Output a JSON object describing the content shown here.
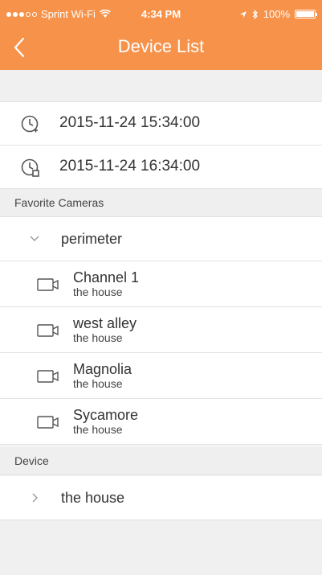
{
  "status_bar": {
    "carrier": "Sprint Wi-Fi",
    "time": "4:34 PM",
    "battery": "100%"
  },
  "header": {
    "title": "Device List"
  },
  "times": [
    {
      "label": "2015-11-24 15:34:00"
    },
    {
      "label": "2015-11-24 16:34:00"
    }
  ],
  "favorites": {
    "section_label": "Favorite Cameras",
    "group_label": "perimeter",
    "cameras": [
      {
        "name": "Channel 1",
        "location": "the house"
      },
      {
        "name": "west alley",
        "location": "the house"
      },
      {
        "name": "Magnolia",
        "location": "the house"
      },
      {
        "name": "Sycamore",
        "location": "the house"
      }
    ]
  },
  "devices": {
    "section_label": "Device",
    "items": [
      {
        "label": "the house"
      }
    ]
  },
  "colors": {
    "accent": "#f7924a"
  }
}
